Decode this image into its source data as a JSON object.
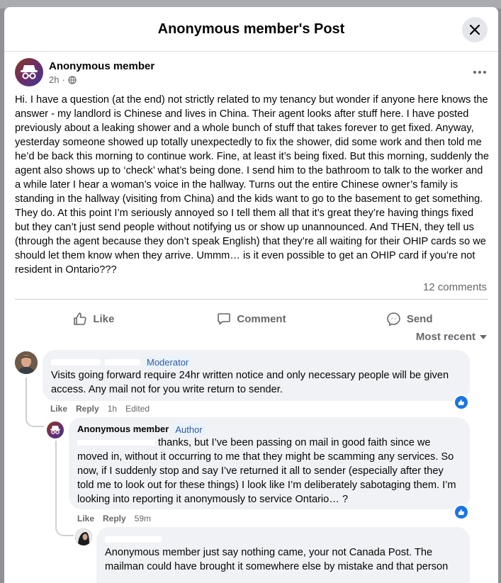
{
  "modal": {
    "title": "Anonymous member's Post"
  },
  "post": {
    "author": "Anonymous member",
    "time": "2h",
    "text": "Hi. I have a question (at the end) not strictly related to my tenancy but wonder if anyone here knows the answer - my landlord is Chinese and lives in China. Their agent looks after stuff here. I have posted previously about a leaking shower and a whole bunch of stuff that takes forever to get fixed. Anyway, yesterday someone showed up totally unexpectedly to fix the shower, did some work and then told me he’d be back this morning to continue work. Fine, at least it’s being fixed. But this morning, suddenly the agent also shows up to ‘check’ what’s being done. I send him to the bathroom to talk to the worker and a while later I hear a woman’s voice in the hallway. Turns out the entire Chinese owner’s family is standing in the hallway (visiting from China) and the kids want to go to the basement to get something. They do. At this point I’m seriously annoyed so I tell them all that it’s great they’re having things fixed but they can’t just send people without notifying us or show up unannounced. And THEN, they tell us (through the agent because they don’t speak English) that they’re all waiting for their OHIP cards so we should let them know when they arrive. Ummm… is it even possible to get an OHIP card if you’re not resident in Ontario???",
    "comments_count": "12 comments"
  },
  "actions": {
    "like": "Like",
    "comment": "Comment",
    "send": "Send"
  },
  "sort": {
    "label": "Most recent"
  },
  "comments": [
    {
      "badge": "Moderator",
      "text": "Visits going forward require 24hr written notice and only necessary people will be given access. Any mail not for you write return to sender.",
      "like": "Like",
      "reply": "Reply",
      "time": "1h",
      "edited": "Edited"
    },
    {
      "author": "Anonymous member",
      "badge": "Author",
      "text": "thanks, but I’ve been passing on mail in good faith since we moved in, without it occurring to me that they might be scamming any services. So now, if I suddenly stop and say I’ve returned it all to sender (especially after they told me to look out for these things) I look like I’m deliberately sabotaging them. I’m looking into reporting it anonymously to service Ontario… ?",
      "like": "Like",
      "reply": "Reply",
      "time": "59m"
    },
    {
      "text": "Anonymous member just say nothing came, your not Canada Post. The mailman could have brought it somewhere else by mistake and that person"
    }
  ],
  "icons": {
    "close": "close-icon",
    "more": "more-options-icon",
    "globe": "globe-icon",
    "like": "thumbs-up-icon",
    "comment": "comment-icon",
    "send": "messenger-icon",
    "sort": "caret-down-icon",
    "reaction": "like-reaction-icon"
  },
  "colors": {
    "accent": "#1b74e4",
    "badge_text": "#385898",
    "badge_bg": "#e7f3ff"
  }
}
